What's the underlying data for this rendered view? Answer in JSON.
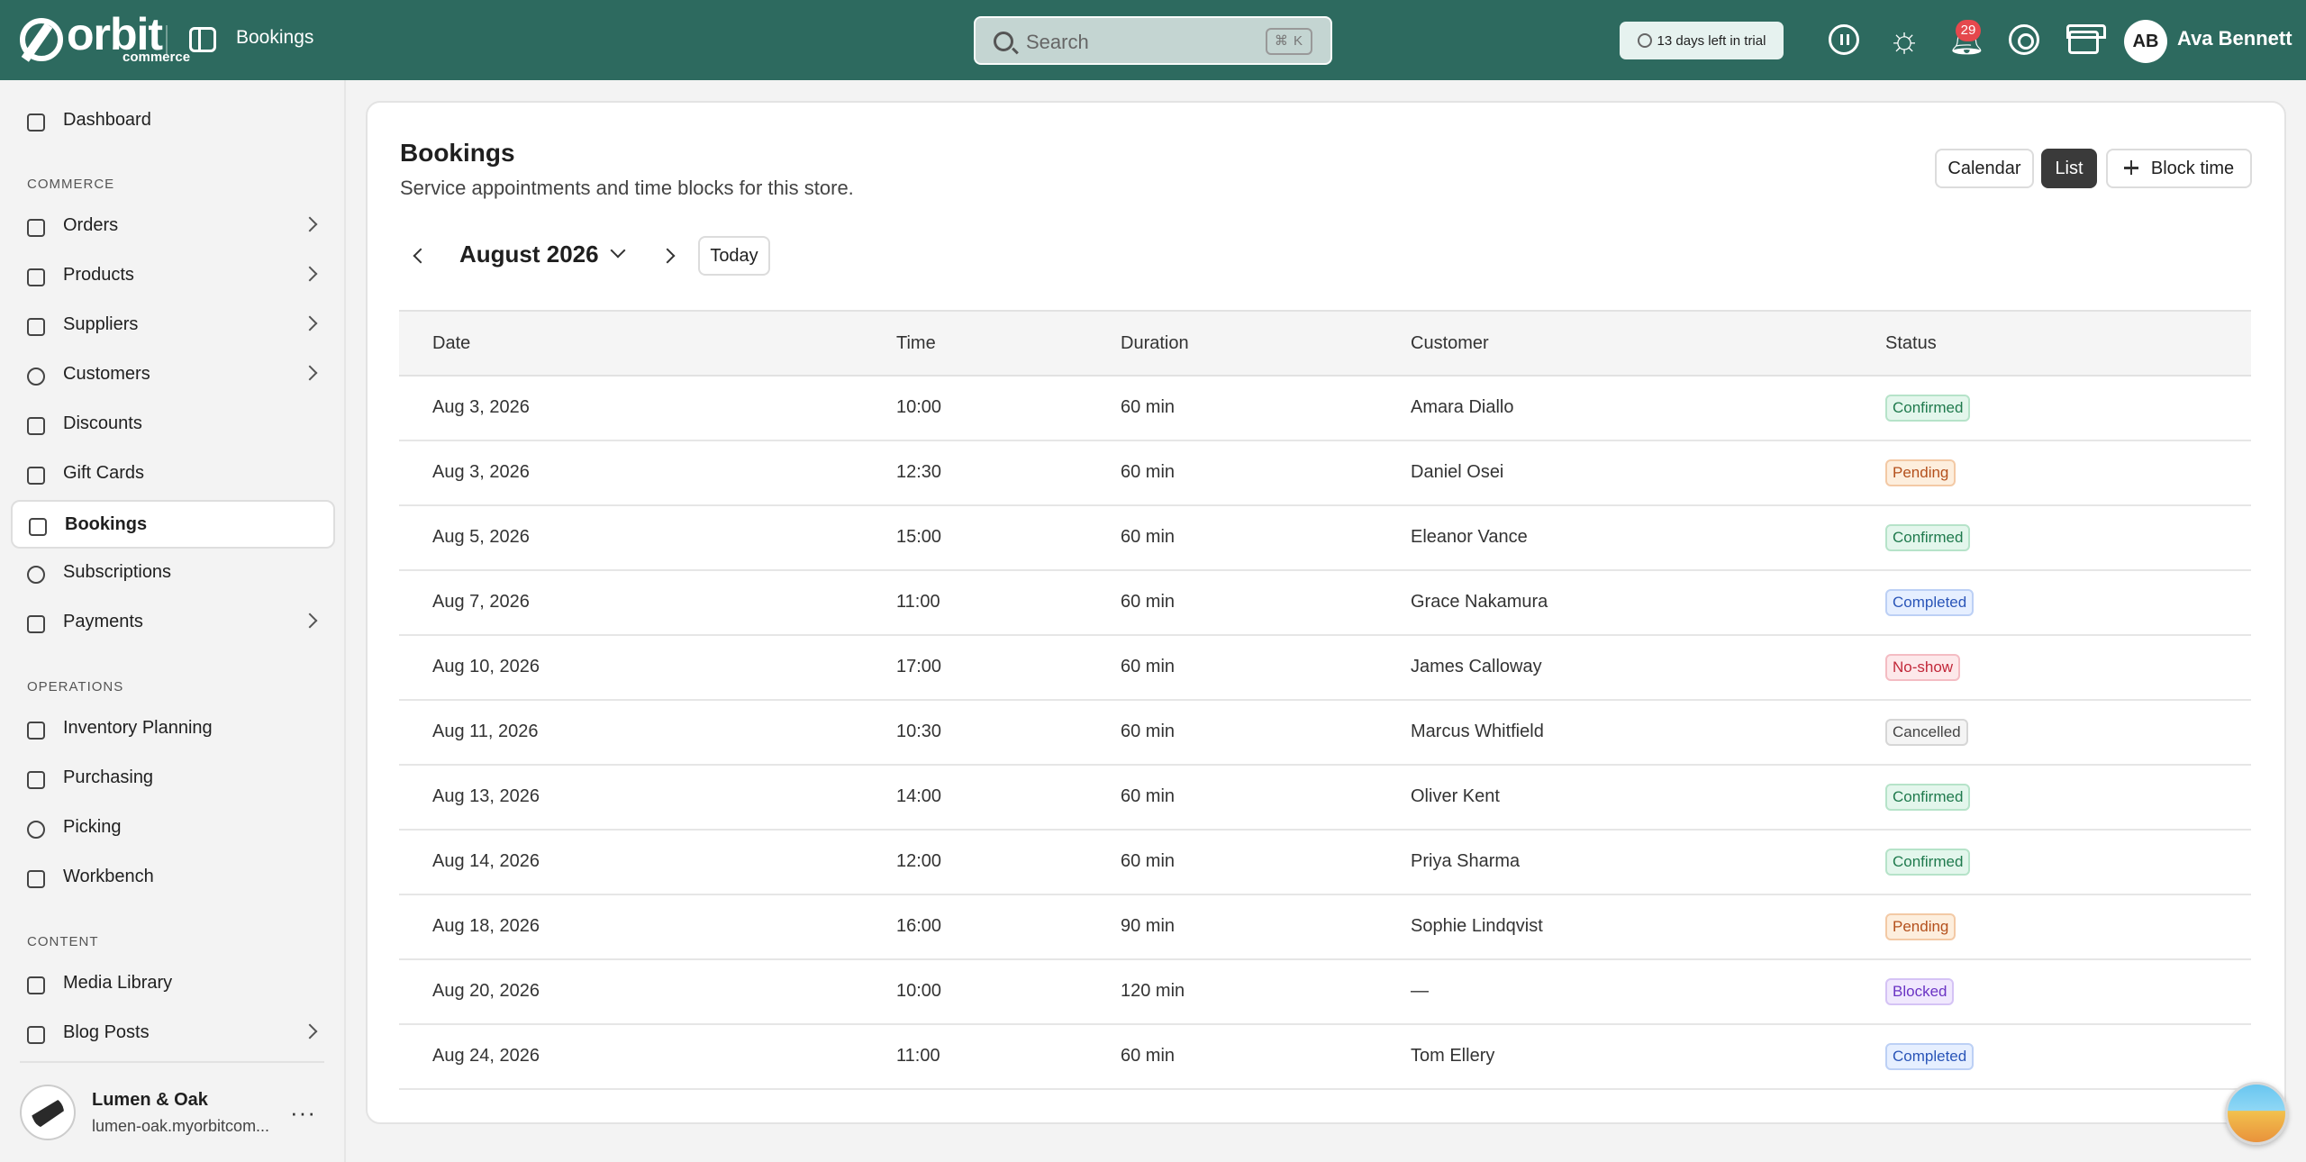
{
  "topbar": {
    "brand": "orbit",
    "brand_sub": "commerce",
    "page_title": "Bookings",
    "search_placeholder": "Search",
    "search_shortcut": "⌘ K",
    "trial_text": "13 days left in trial",
    "notifications_count": "29",
    "user_initials": "AB",
    "user_name": "Ava Bennett"
  },
  "sidebar": {
    "dashboard": "Dashboard",
    "section_commerce": "COMMERCE",
    "orders": "Orders",
    "products": "Products",
    "suppliers": "Suppliers",
    "customers": "Customers",
    "discounts": "Discounts",
    "gift_cards": "Gift Cards",
    "bookings": "Bookings",
    "subscriptions": "Subscriptions",
    "payments": "Payments",
    "section_operations": "OPERATIONS",
    "inventory_planning": "Inventory Planning",
    "purchasing": "Purchasing",
    "picking": "Picking",
    "workbench": "Workbench",
    "section_content": "CONTENT",
    "media_library": "Media Library",
    "blog_posts": "Blog Posts",
    "store_name": "Lumen & Oak",
    "store_url": "lumen-oak.myorbitcom...",
    "store_more": "···"
  },
  "main": {
    "title": "Bookings",
    "subtitle": "Service appointments and time blocks for this store.",
    "view_calendar": "Calendar",
    "view_list": "List",
    "block_time": "Block time",
    "month": "August 2026",
    "today": "Today",
    "columns": [
      "Date",
      "Time",
      "Duration",
      "Customer",
      "Status"
    ],
    "rows": [
      {
        "date": "Aug 3, 2026",
        "time": "10:00",
        "duration": "60 min",
        "customer": "Amara Diallo",
        "status": "Confirmed"
      },
      {
        "date": "Aug 3, 2026",
        "time": "12:30",
        "duration": "60 min",
        "customer": "Daniel Osei",
        "status": "Pending"
      },
      {
        "date": "Aug 5, 2026",
        "time": "15:00",
        "duration": "60 min",
        "customer": "Eleanor Vance",
        "status": "Confirmed"
      },
      {
        "date": "Aug 7, 2026",
        "time": "11:00",
        "duration": "60 min",
        "customer": "Grace Nakamura",
        "status": "Completed"
      },
      {
        "date": "Aug 10, 2026",
        "time": "17:00",
        "duration": "60 min",
        "customer": "James Calloway",
        "status": "No-show"
      },
      {
        "date": "Aug 11, 2026",
        "time": "10:30",
        "duration": "60 min",
        "customer": "Marcus Whitfield",
        "status": "Cancelled"
      },
      {
        "date": "Aug 13, 2026",
        "time": "14:00",
        "duration": "60 min",
        "customer": "Oliver Kent",
        "status": "Confirmed"
      },
      {
        "date": "Aug 14, 2026",
        "time": "12:00",
        "duration": "60 min",
        "customer": "Priya Sharma",
        "status": "Confirmed"
      },
      {
        "date": "Aug 18, 2026",
        "time": "16:00",
        "duration": "90 min",
        "customer": "Sophie Lindqvist",
        "status": "Pending"
      },
      {
        "date": "Aug 20, 2026",
        "time": "10:00",
        "duration": "120 min",
        "customer": "—",
        "status": "Blocked"
      },
      {
        "date": "Aug 24, 2026",
        "time": "11:00",
        "duration": "60 min",
        "customer": "Tom Ellery",
        "status": "Completed"
      }
    ]
  },
  "status_colors": {
    "Confirmed": {
      "bg": "#e3f6ec",
      "fg": "#1f7a4d",
      "border": "#b6e3c9"
    },
    "Pending": {
      "bg": "#fdeedd",
      "fg": "#b4501c",
      "border": "#f3c9a5"
    },
    "Completed": {
      "bg": "#e6efff",
      "fg": "#2a55b8",
      "border": "#bcd0f5"
    },
    "No-show": {
      "bg": "#fde8ea",
      "fg": "#c2283a",
      "border": "#f4bcc3"
    },
    "Cancelled": {
      "bg": "#f4f4f4",
      "fg": "#444444",
      "border": "#d6d6d6"
    },
    "Blocked": {
      "bg": "#f0e8fd",
      "fg": "#6b34c4",
      "border": "#d5c3f5"
    }
  },
  "colors": {
    "topbar": "#2d6a5f",
    "accent_dark": "#3a3a3a"
  }
}
